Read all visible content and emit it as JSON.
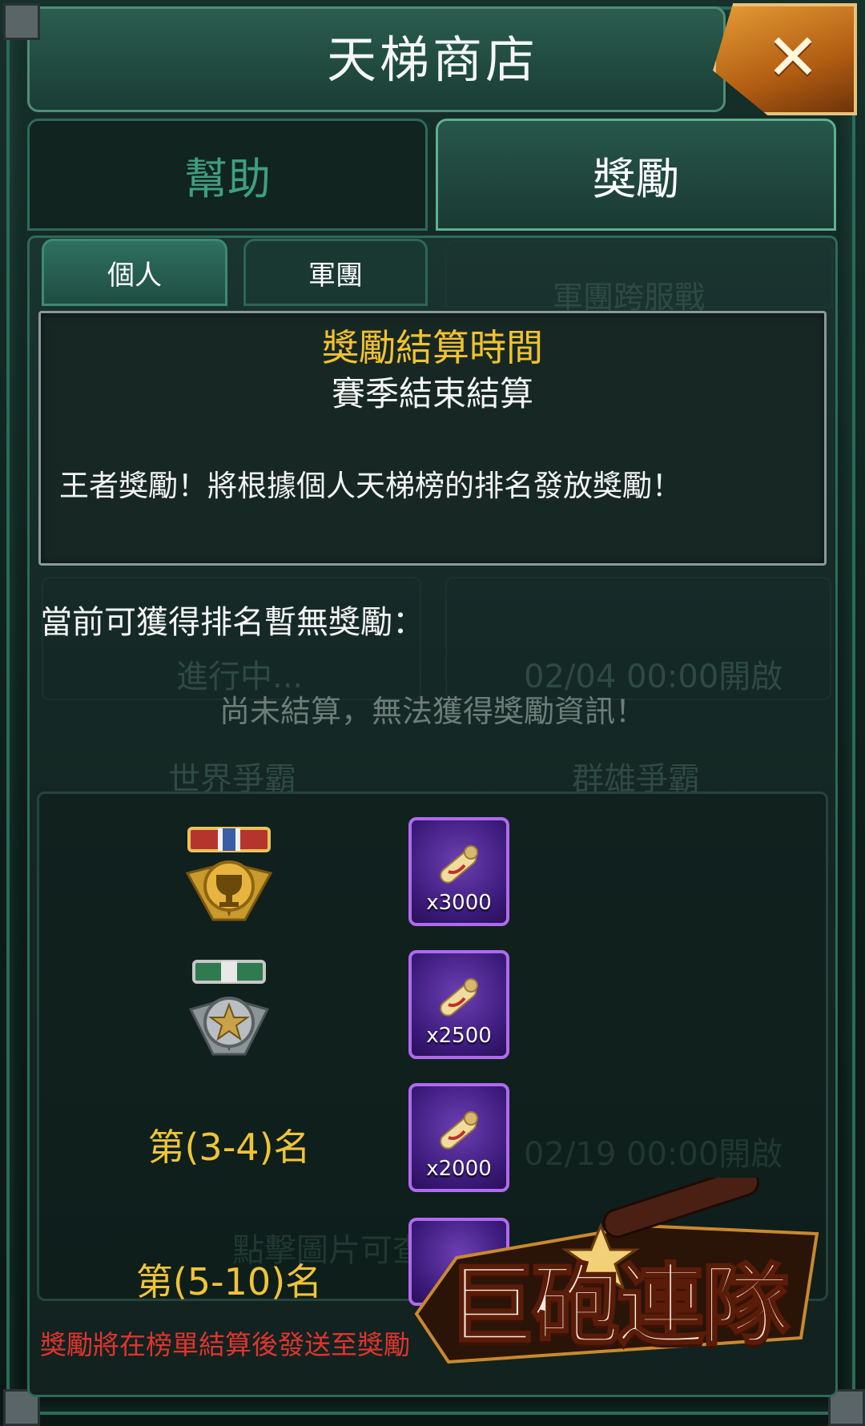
{
  "header": {
    "title": "天梯商店"
  },
  "tabs": [
    {
      "label": "幫助"
    },
    {
      "label": "獎勵"
    }
  ],
  "subtabs": [
    {
      "label": "個人"
    },
    {
      "label": "軍團"
    }
  ],
  "info": {
    "title": "獎勵結算時間",
    "subtitle": "賽季結束結算",
    "description": "王者獎勵！將根據個人天梯榜的排名發放獎勵！"
  },
  "current_label": "當前可獲得排名暫無獎勵：",
  "notice": "尚未結算，無法獲得獎勵資訊！",
  "background_ghost": {
    "legion_battle": "軍團跨服戰",
    "in_progress": "進行中...",
    "date1": "02/04 00:00開啟",
    "world": "世界爭霸",
    "heroes": "群雄爭霸",
    "date2": "02/19 00:00開啟",
    "tap_hint": "點擊圖片可查"
  },
  "ranks": [
    {
      "label": "",
      "medal": "gold-cup-medal-icon",
      "reward_icon": "scroll-icon",
      "reward_count": "x3000"
    },
    {
      "label": "",
      "medal": "silver-star-medal-icon",
      "reward_icon": "scroll-icon",
      "reward_count": "x2500"
    },
    {
      "label": "第(3-4)名",
      "reward_icon": "scroll-icon",
      "reward_count": "x2000"
    },
    {
      "label": "第(5-10)名",
      "reward_icon": "scroll-icon",
      "reward_count": ""
    }
  ],
  "footer_note": "獎勵將在榜單結算後發送至獎勵",
  "logo": {
    "text": "巨砲連隊"
  },
  "colors": {
    "accent_gold": "#f2c230",
    "warning_red": "#e0342e",
    "reward_purple": "#6c3fb3"
  }
}
